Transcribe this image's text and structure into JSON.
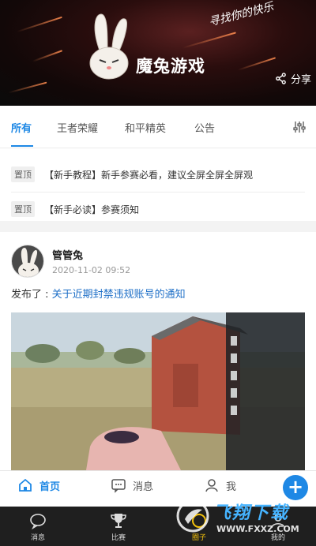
{
  "header": {
    "brand": "魔兔游戏",
    "slogan": "寻找你的快乐",
    "share_label": "分享"
  },
  "tabs": [
    {
      "label": "所有",
      "active": true
    },
    {
      "label": "王者荣耀"
    },
    {
      "label": "和平精英"
    },
    {
      "label": "公告"
    }
  ],
  "notices": [
    {
      "pin": "置顶",
      "text": "【新手教程】新手参赛必看，建议全屏全屏全屏观"
    },
    {
      "pin": "置顶",
      "text": "【新手必读】参赛须知"
    }
  ],
  "post": {
    "author": "管管兔",
    "time": "2020-11-02 09:52",
    "prefix": "发布了 : ",
    "link": "关于近期封禁违规账号的通知"
  },
  "nav": {
    "home": "首页",
    "messages": "消息",
    "me": "我",
    "fab": "+"
  },
  "system_bar": {
    "items": [
      "消息",
      "比赛",
      "圈子",
      "我的"
    ]
  },
  "watermark": {
    "title": "飞翔下载",
    "url": "WWW.FXXZ.COM"
  },
  "colors": {
    "accent": "#1e88e5",
    "link": "#1e6fc7"
  }
}
